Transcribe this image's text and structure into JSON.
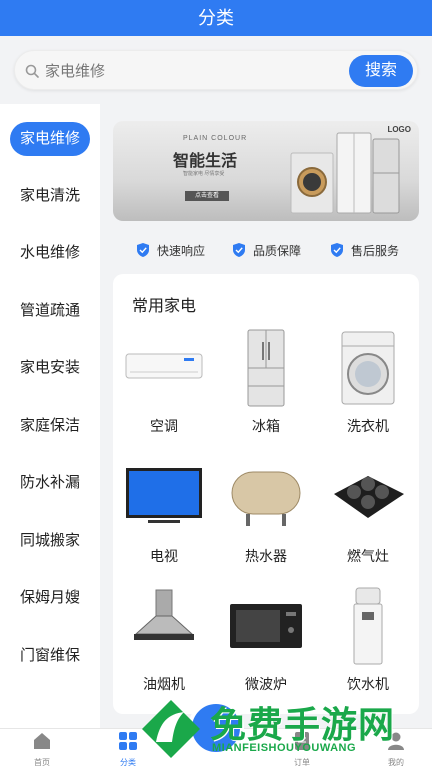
{
  "header": {
    "title": "分类"
  },
  "search": {
    "placeholder": "家电维修",
    "button_label": "搜索"
  },
  "sidebar": {
    "items": [
      {
        "label": "家电维修",
        "active": true
      },
      {
        "label": "家电清洗"
      },
      {
        "label": "水电维修"
      },
      {
        "label": "管道疏通"
      },
      {
        "label": "家电安装"
      },
      {
        "label": "家庭保洁"
      },
      {
        "label": "防水补漏"
      },
      {
        "label": "同城搬家"
      },
      {
        "label": "保姆月嫂"
      },
      {
        "label": "门窗维保"
      }
    ]
  },
  "banner": {
    "logo": "LOGO",
    "subtitle": "PLAIN COLOUR",
    "title": "智能生活",
    "desc": "智能家电 尽情享受",
    "button_label": "点击查看"
  },
  "features": [
    {
      "label": "快速响应",
      "icon": "shield-check-icon"
    },
    {
      "label": "品质保障",
      "icon": "shield-check-icon"
    },
    {
      "label": "售后服务",
      "icon": "shield-check-icon"
    }
  ],
  "section": {
    "title": "常用家电",
    "items": [
      {
        "label": "空调",
        "icon": "air-conditioner-icon"
      },
      {
        "label": "冰箱",
        "icon": "refrigerator-icon"
      },
      {
        "label": "洗衣机",
        "icon": "washing-machine-icon"
      },
      {
        "label": "电视",
        "icon": "tv-icon"
      },
      {
        "label": "热水器",
        "icon": "water-heater-icon"
      },
      {
        "label": "燃气灶",
        "icon": "gas-stove-icon"
      },
      {
        "label": "油烟机",
        "icon": "range-hood-icon"
      },
      {
        "label": "微波炉",
        "icon": "microwave-icon"
      },
      {
        "label": "饮水机",
        "icon": "water-dispenser-icon"
      }
    ]
  },
  "tabbar": {
    "items": [
      {
        "label": "首页",
        "icon": "home-icon"
      },
      {
        "label": "分类",
        "icon": "category-icon",
        "active": true
      },
      {
        "label": "订单",
        "icon": "order-icon"
      },
      {
        "label": "我的",
        "icon": "user-icon"
      }
    ]
  },
  "watermark": {
    "text": "免费手游网",
    "sub": "MIANFEISHOUYOUWANG"
  },
  "colors": {
    "primary": "#2f7bf2",
    "background": "#f2f3f5",
    "watermark": "#1aa84a"
  }
}
